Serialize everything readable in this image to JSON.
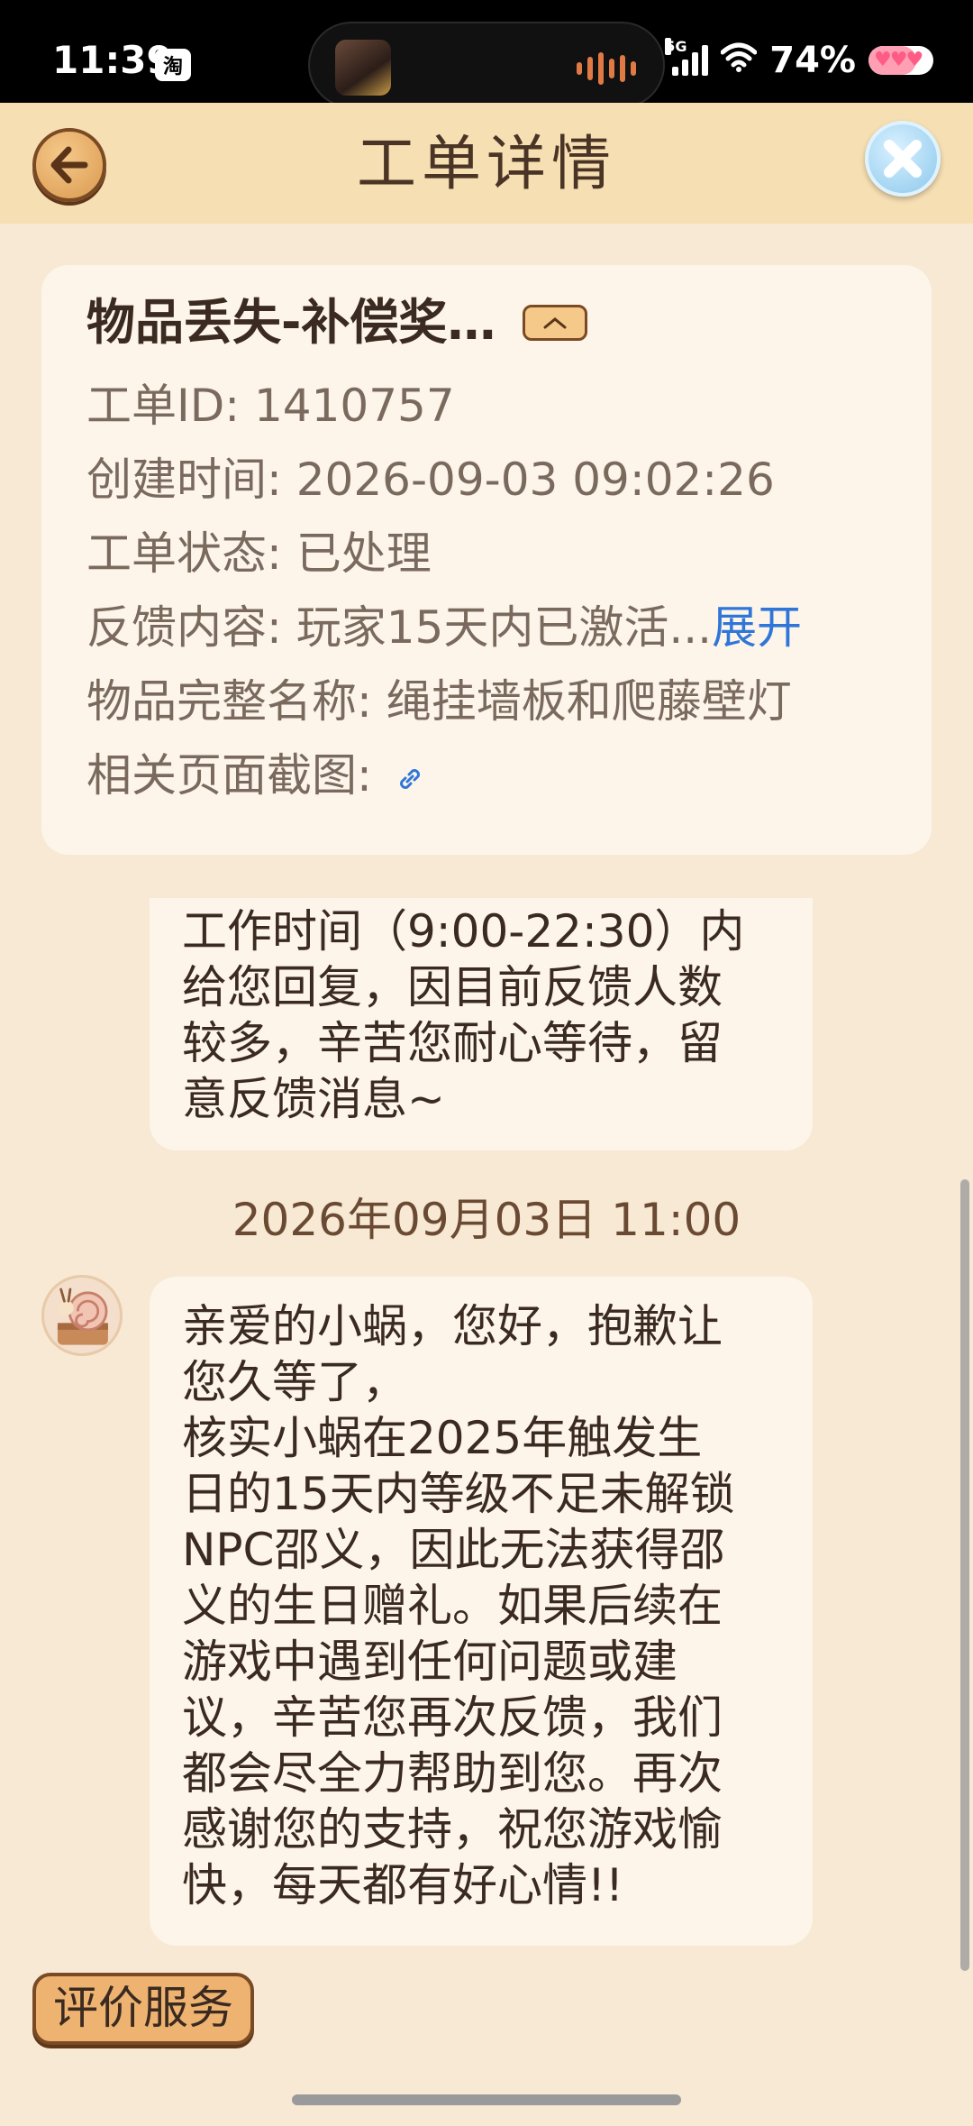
{
  "status_bar": {
    "time": "11:39",
    "app_badge": "淘",
    "network": "5G",
    "battery_text": "74%",
    "battery_level": 0.74,
    "icons": [
      "taobao-icon",
      "game-avatar-icon",
      "audio-wave-icon",
      "signal-icon",
      "wifi-icon",
      "battery-icon"
    ]
  },
  "header": {
    "title": "工单详情",
    "back_icon": "arrow-left-icon",
    "close_icon": "close-icon"
  },
  "ticket": {
    "title": "物品丢失-补偿奖…",
    "id_label": "工单ID: ",
    "id_value": "1410757",
    "created_label": "创建时间: ",
    "created_value": "2026-09-03 09:02:26",
    "status_label": "工单状态: ",
    "status_value": "已处理",
    "feedback_label": "反馈内容: ",
    "feedback_value": "玩家15天内已激活...",
    "expand_label": "展开",
    "item_label": "物品完整名称: ",
    "item_value": "绳挂墙板和爬藤壁灯",
    "screenshot_label": "相关页面截图: ",
    "screenshot_icon": "link-icon"
  },
  "messages": {
    "first": {
      "lines": [
        "工作时间（9:00-22:30）内",
        "给您回复，因目前反馈人数",
        "较多，辛苦您耐心等待，留",
        "意反馈消息~"
      ]
    },
    "timestamp": "2026年09月03日 11:00",
    "second": {
      "lines": [
        "亲爱的小蜗，您好，抱歉让",
        "您久等了，",
        "核实小蜗在2025年触发生",
        "日的15天内等级不足未解锁",
        "NPC邵义，因此无法获得邵",
        "义的生日赠礼。如果后续在",
        "游戏中遇到任何问题或建",
        "议，辛苦您再次反馈，我们",
        "都会尽全力帮助到您。再次",
        "感谢您的支持，祝您游戏愉",
        "快，每天都有好心情!!"
      ]
    }
  },
  "footer": {
    "rate_button": "评价服务"
  },
  "colors": {
    "background": "#f7e9d4",
    "header": "#f6dfb3",
    "card": "#fdf5ea",
    "link": "#2f76d8",
    "button": "#eeb371"
  }
}
